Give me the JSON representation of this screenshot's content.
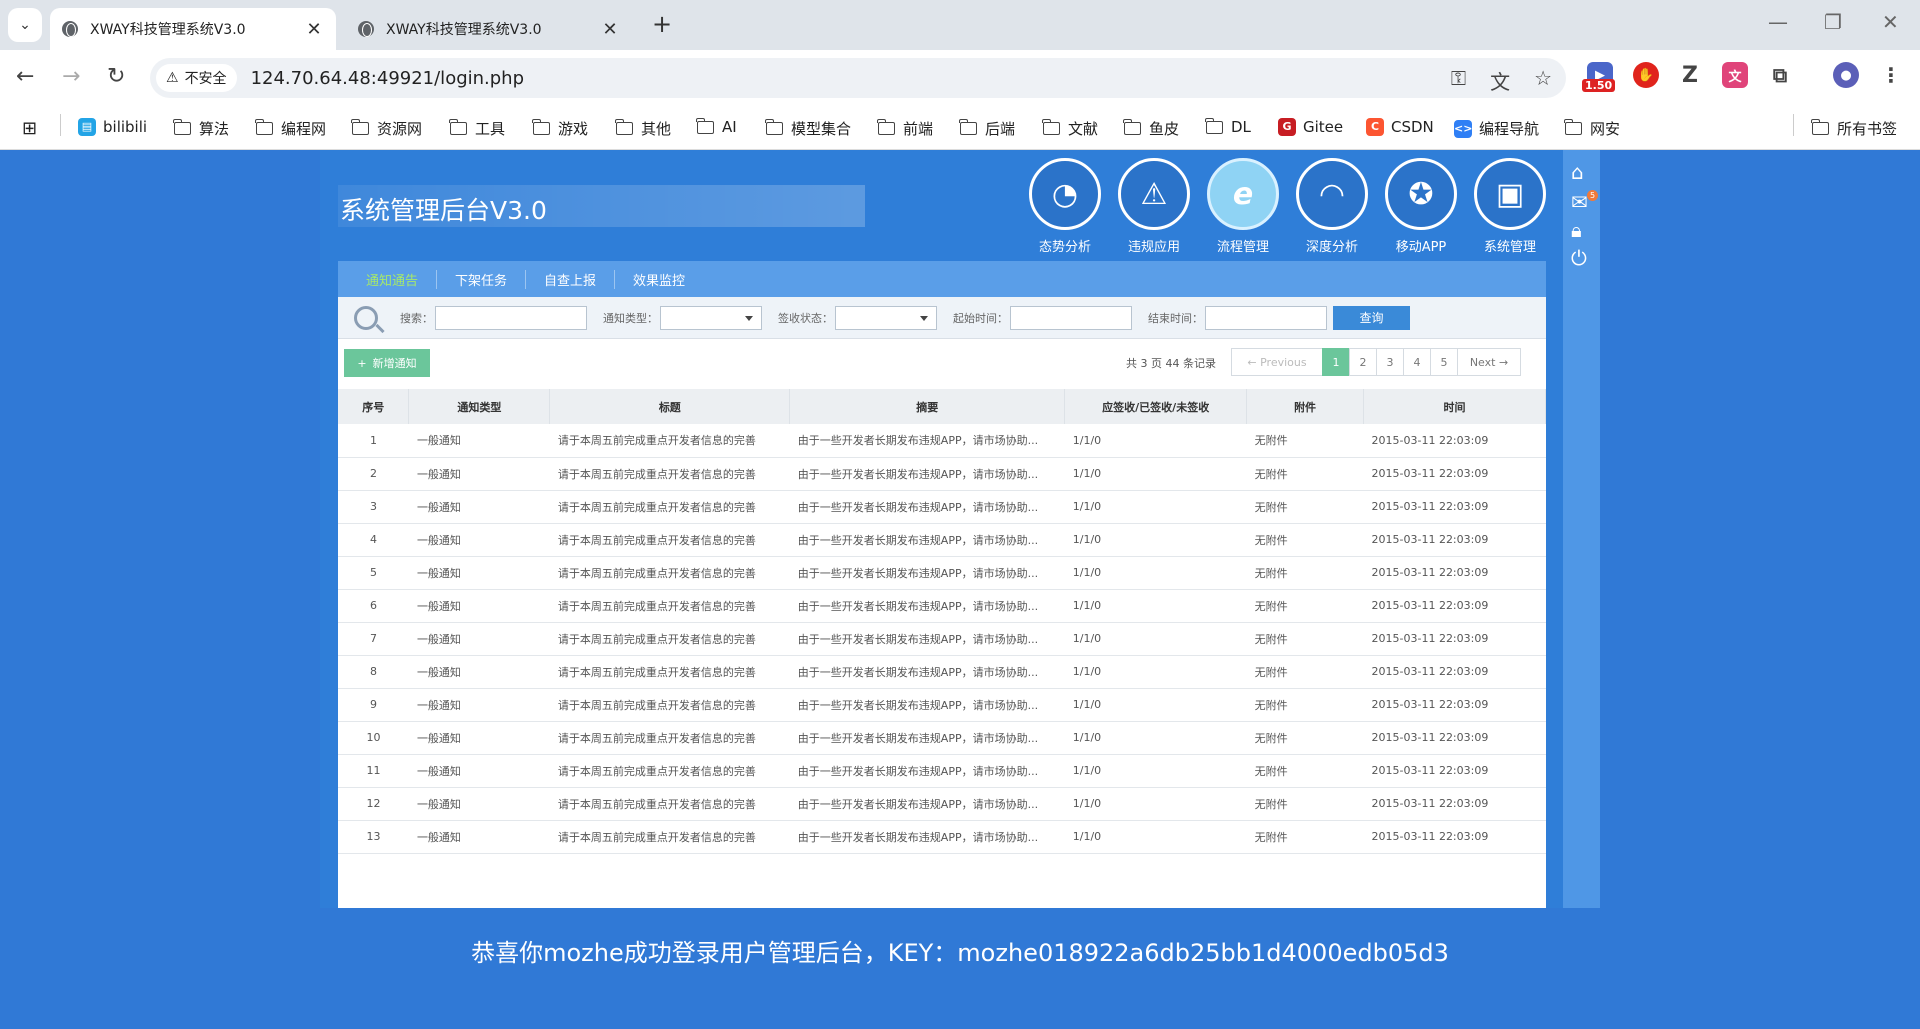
{
  "browser": {
    "tabs": [
      {
        "title": "XWAY科技管理系统V3.0",
        "active": true
      },
      {
        "title": "XWAY科技管理系统V3.0",
        "active": false
      }
    ],
    "security_label": "不安全",
    "url": "124.70.64.48:49921/login.php",
    "extension_badge": "1.50",
    "bookmarks": [
      "bilibili",
      "算法",
      "编程网",
      "资源网",
      "工具",
      "游戏",
      "其他",
      "AI",
      "模型集合",
      "前端",
      "后端",
      "文献",
      "鱼皮",
      "DL",
      "Gitee",
      "CSDN",
      "编程导航",
      "网安"
    ],
    "all_bookmarks": "所有书签"
  },
  "app": {
    "title": "系统管理后台V3.0",
    "modules": [
      {
        "label": "态势分析",
        "icon": "pie-chart-icon"
      },
      {
        "label": "违规应用",
        "icon": "warning-icon"
      },
      {
        "label": "流程管理",
        "icon": "ie-icon"
      },
      {
        "label": "深度分析",
        "icon": "gauge-icon"
      },
      {
        "label": "移动APP",
        "icon": "star-badge-icon"
      },
      {
        "label": "系统管理",
        "icon": "image-icon"
      }
    ],
    "rightbar_badge": "5",
    "subtabs": [
      "通知通告",
      "下架任务",
      "自查上报",
      "效果监控"
    ],
    "search": {
      "keyword_label": "搜索：",
      "type_label": "通知类型：",
      "sign_label": "签收状态：",
      "start_label": "起始时间：",
      "end_label": "结束时间：",
      "query_button": "查询"
    },
    "add_button": "新增通知",
    "page_info": "共 3 页 44 条记录",
    "pager": {
      "prev": "← Previous",
      "pages": [
        "1",
        "2",
        "3",
        "4",
        "5"
      ],
      "next": "Next →"
    },
    "table": {
      "headers": [
        "序号",
        "通知类型",
        "标题",
        "摘要",
        "应签收/已签收/未签收",
        "附件",
        "时间"
      ],
      "rows": [
        [
          "1",
          "一般通知",
          "请于本周五前完成重点开发者信息的完善",
          "由于一些开发者长期发布违规APP，请市场协助...",
          "1/1/0",
          "无附件",
          "2015-03-11 22:03:09"
        ],
        [
          "2",
          "一般通知",
          "请于本周五前完成重点开发者信息的完善",
          "由于一些开发者长期发布违规APP，请市场协助...",
          "1/1/0",
          "无附件",
          "2015-03-11 22:03:09"
        ],
        [
          "3",
          "一般通知",
          "请于本周五前完成重点开发者信息的完善",
          "由于一些开发者长期发布违规APP，请市场协助...",
          "1/1/0",
          "无附件",
          "2015-03-11 22:03:09"
        ],
        [
          "4",
          "一般通知",
          "请于本周五前完成重点开发者信息的完善",
          "由于一些开发者长期发布违规APP，请市场协助...",
          "1/1/0",
          "无附件",
          "2015-03-11 22:03:09"
        ],
        [
          "5",
          "一般通知",
          "请于本周五前完成重点开发者信息的完善",
          "由于一些开发者长期发布违规APP，请市场协助...",
          "1/1/0",
          "无附件",
          "2015-03-11 22:03:09"
        ],
        [
          "6",
          "一般通知",
          "请于本周五前完成重点开发者信息的完善",
          "由于一些开发者长期发布违规APP，请市场协助...",
          "1/1/0",
          "无附件",
          "2015-03-11 22:03:09"
        ],
        [
          "7",
          "一般通知",
          "请于本周五前完成重点开发者信息的完善",
          "由于一些开发者长期发布违规APP，请市场协助...",
          "1/1/0",
          "无附件",
          "2015-03-11 22:03:09"
        ],
        [
          "8",
          "一般通知",
          "请于本周五前完成重点开发者信息的完善",
          "由于一些开发者长期发布违规APP，请市场协助...",
          "1/1/0",
          "无附件",
          "2015-03-11 22:03:09"
        ],
        [
          "9",
          "一般通知",
          "请于本周五前完成重点开发者信息的完善",
          "由于一些开发者长期发布违规APP，请市场协助...",
          "1/1/0",
          "无附件",
          "2015-03-11 22:03:09"
        ],
        [
          "10",
          "一般通知",
          "请于本周五前完成重点开发者信息的完善",
          "由于一些开发者长期发布违规APP，请市场协助...",
          "1/1/0",
          "无附件",
          "2015-03-11 22:03:09"
        ],
        [
          "11",
          "一般通知",
          "请于本周五前完成重点开发者信息的完善",
          "由于一些开发者长期发布违规APP，请市场协助...",
          "1/1/0",
          "无附件",
          "2015-03-11 22:03:09"
        ],
        [
          "12",
          "一般通知",
          "请于本周五前完成重点开发者信息的完善",
          "由于一些开发者长期发布违规APP，请市场协助...",
          "1/1/0",
          "无附件",
          "2015-03-11 22:03:09"
        ],
        [
          "13",
          "一般通知",
          "请于本周五前完成重点开发者信息的完善",
          "由于一些开发者长期发布违规APP，请市场协助...",
          "1/1/0",
          "无附件",
          "2015-03-11 22:03:09"
        ]
      ]
    }
  },
  "message": "恭喜你mozhe成功登录用户管理后台，KEY：mozhe018922a6db25bb1d4000edb05d3",
  "colors": {
    "page_bg": "#3079d6",
    "active_page": "#6bc69b",
    "query_button": "#3a8ad8"
  }
}
